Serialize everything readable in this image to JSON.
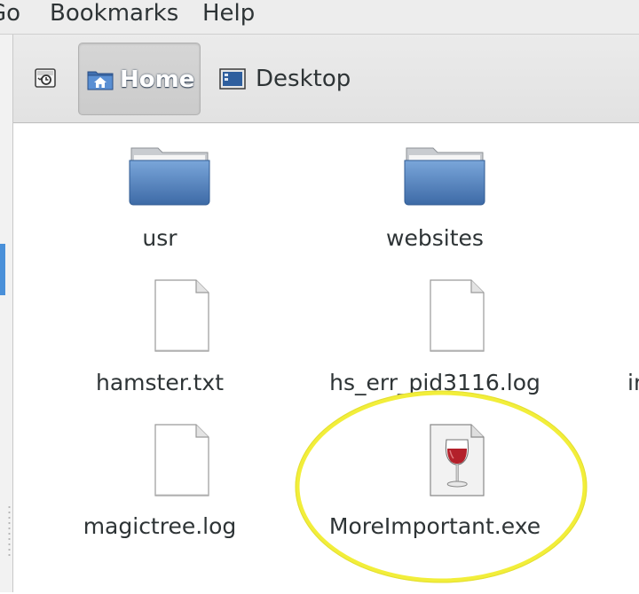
{
  "menu": {
    "go_label": "Go",
    "bookmarks_label": "Bookmarks",
    "help_label": "Help"
  },
  "pathbar": {
    "history_icon": "history-icon",
    "home_label": "Home",
    "home_icon": "home-folder-icon",
    "desktop_label": "Desktop",
    "desktop_icon": "desktop-icon",
    "active": "Home"
  },
  "files": [
    {
      "name": "usr",
      "type": "folder",
      "icon": "folder-icon"
    },
    {
      "name": "websites",
      "type": "folder",
      "icon": "folder-icon"
    },
    {
      "name": "hamster.txt",
      "type": "document",
      "icon": "text-file-icon"
    },
    {
      "name": "hs_err_pid3116.log",
      "type": "document",
      "icon": "text-file-icon"
    },
    {
      "name": "magictree.log",
      "type": "document",
      "icon": "text-file-icon"
    },
    {
      "name": "MoreImportant.exe",
      "type": "executable",
      "icon": "wine-glass-icon"
    }
  ],
  "partial_file_label": "in",
  "annotation": {
    "shape": "ellipse",
    "color": "#f2ee3a",
    "target": "MoreImportant.exe"
  },
  "colors": {
    "folder_blue": "#4f7fb8",
    "accent": "#4a90d9",
    "wine_red": "#b3202a"
  }
}
